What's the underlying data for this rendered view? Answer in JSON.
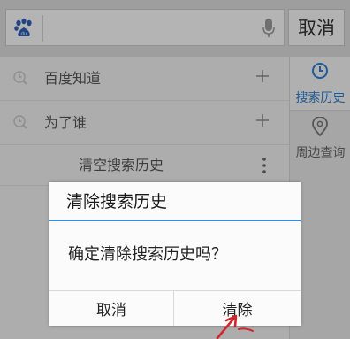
{
  "search": {
    "cancel_label": "取消",
    "logo_text": "du"
  },
  "history": {
    "items": [
      {
        "label": "百度知道"
      },
      {
        "label": "为了谁"
      }
    ],
    "clear_label": "清空搜索历史"
  },
  "side_panel": {
    "items": [
      {
        "label": "搜索历史",
        "icon": "clock-icon",
        "active": true
      },
      {
        "label": "周边查询",
        "icon": "location-pin-icon",
        "active": false
      }
    ]
  },
  "dialog": {
    "title": "清除搜索历史",
    "message": "确定清除搜索历史吗？",
    "cancel_label": "取消",
    "confirm_label": "清除"
  },
  "colors": {
    "accent": "#2e7ed0",
    "title_line": "#3a8fd8",
    "annotation_arrow": "#d0262b"
  }
}
